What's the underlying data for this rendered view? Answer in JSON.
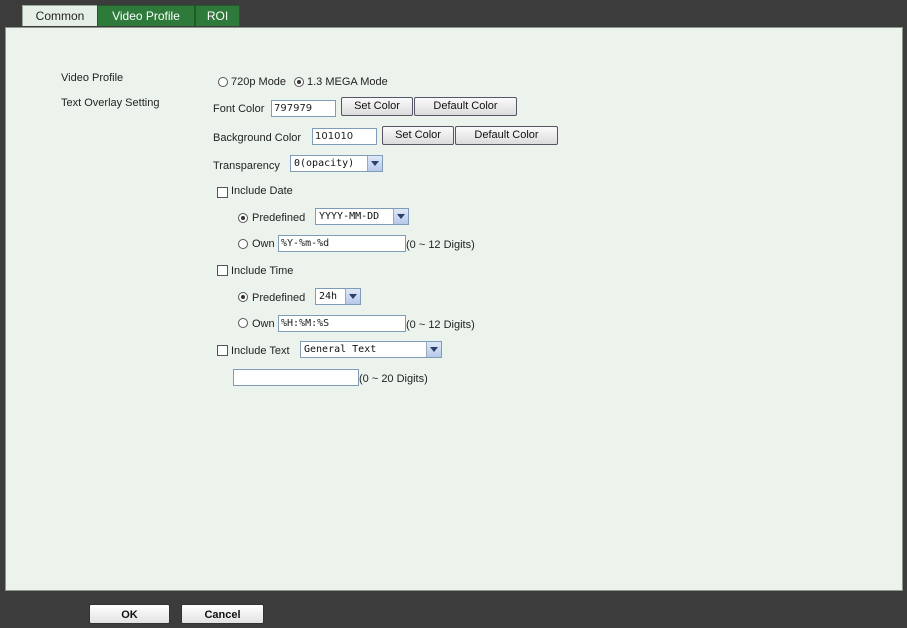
{
  "tabs": [
    {
      "label": "Common",
      "active": false
    },
    {
      "label": "Video Profile",
      "active": true
    },
    {
      "label": "ROI",
      "active": false
    }
  ],
  "video_profile": {
    "label": "Video Profile",
    "options": [
      "720p Mode",
      "1.3 MEGA Mode"
    ],
    "selected": "1.3 MEGA Mode"
  },
  "text_overlay": {
    "label": "Text Overlay Setting",
    "font_color_label": "Font Color",
    "font_color_value": "797979",
    "background_color_label": "Background Color",
    "background_color_value": "101010",
    "set_color_label": "Set Color",
    "default_color_label": "Default Color",
    "transparency_label": "Transparency",
    "transparency_value": "0(opacity)"
  },
  "include_date": {
    "label": "Include Date",
    "checked": false,
    "predefined_label": "Predefined",
    "predefined_value": "YYYY-MM-DD",
    "own_label": "Own",
    "own_value": "%Y-%m-%d",
    "hint": "(0 ~ 12 Digits)"
  },
  "include_time": {
    "label": "Include Time",
    "checked": false,
    "predefined_label": "Predefined",
    "predefined_value": "24h",
    "own_label": "Own",
    "own_value": "%H:%M:%S",
    "hint": "(0 ~ 12 Digits)"
  },
  "include_text": {
    "label": "Include Text",
    "checked": false,
    "type_value": "General Text",
    "text_value": "",
    "hint": "(0 ~ 20 Digits)"
  },
  "footer": {
    "ok_label": "OK",
    "cancel_label": "Cancel"
  },
  "colors": {
    "active_tab": "#2e7a3a",
    "panel_bg": "#ecf3ec",
    "frame_bg": "#3c3c3c"
  }
}
